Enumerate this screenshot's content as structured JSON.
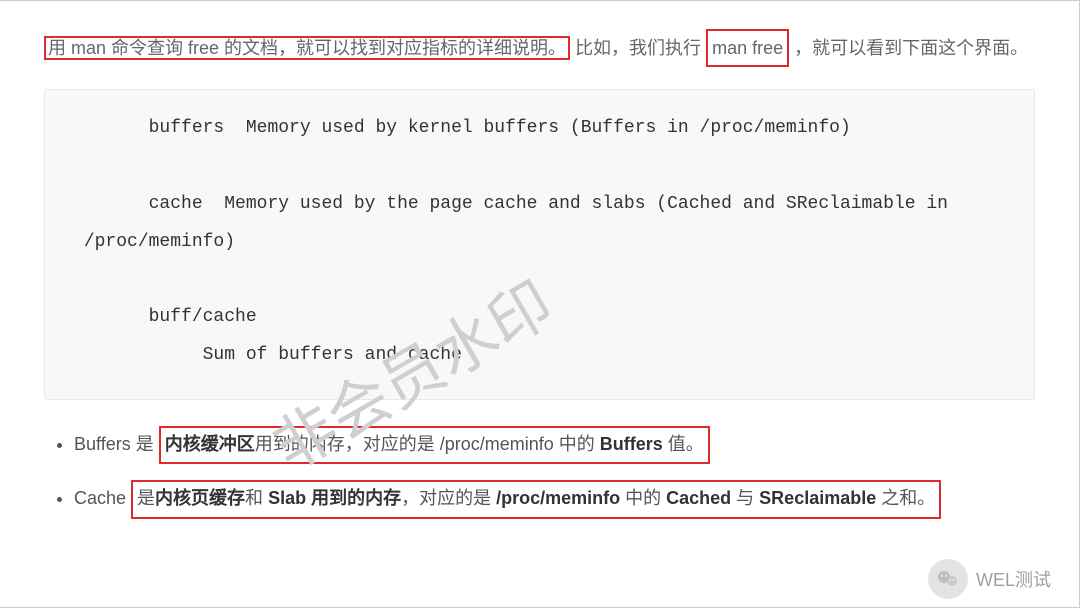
{
  "intro": {
    "seg1": "用 man 命令查询 free 的文档，就可以找到对应指标的详细说明。",
    "seg2": "比如，我们执行",
    "seg3": "man free",
    "seg4": "，就可以看到下面这个界面。"
  },
  "code": "       buffers  Memory used by kernel buffers (Buffers in /proc/meminfo)\n\n       cache  Memory used by the page cache and slabs (Cached and SReclaimable in \n /proc/meminfo)\n\n       buff/cache\n            Sum of buffers and cache",
  "bullets": {
    "b1": {
      "pre": "Buffers 是",
      "box_pre": "内核缓冲区",
      "box_mid1": "用到的内存，对应的是 /proc/meminfo 中的 ",
      "box_strong1": "Buffers",
      "box_end": " 值。"
    },
    "b2": {
      "pre": "Cache ",
      "box_pre1": "是",
      "box_strong1": "内核页缓存",
      "box_mid1": "和 ",
      "box_strong2": "Slab 用到的内存",
      "box_mid2": "，对应的是 ",
      "box_strong3": "/proc/meminfo",
      "box_mid3": " 中的 ",
      "box_strong4": "Cached",
      "box_mid4": " 与 ",
      "box_strong5": "SReclaimable",
      "box_end": " 之和。"
    }
  },
  "watermark": "非会员水印",
  "footer": {
    "label": "WEL测试"
  }
}
